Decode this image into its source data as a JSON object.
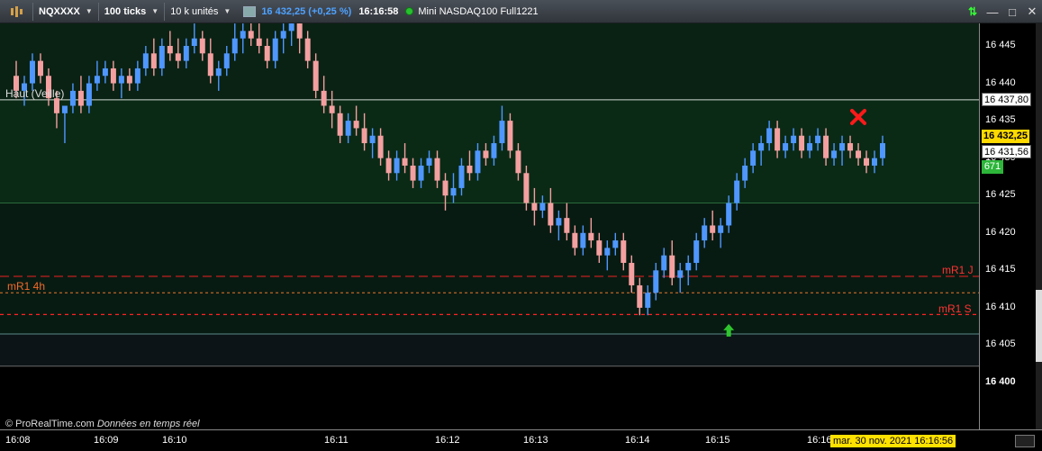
{
  "toolbar": {
    "symbol": "NQXXXX",
    "interval": "100 ticks",
    "units": "10 k unités",
    "last_price": "16 432,25 (+0,25 %)",
    "time": "16:16:58",
    "instrument": "Mini NASDAQ100 Full1221",
    "window_buttons": {
      "minimize": "—",
      "maximize": "□",
      "close": "✕"
    }
  },
  "chart": {
    "y_ticks": [
      {
        "label": "16 445",
        "value": 16445
      },
      {
        "label": "16 440",
        "value": 16440
      },
      {
        "label": "16 435",
        "value": 16435
      },
      {
        "label": "16 430",
        "value": 16430
      },
      {
        "label": "16 425",
        "value": 16425
      },
      {
        "label": "16 420",
        "value": 16420
      },
      {
        "label": "16 415",
        "value": 16415
      },
      {
        "label": "16 410",
        "value": 16410
      },
      {
        "label": "16 405",
        "value": 16405
      },
      {
        "label": "16 400",
        "value": 16400
      }
    ],
    "x_ticks": [
      "16:08",
      "16:09",
      "16:10",
      "16:11",
      "16:12",
      "16:13",
      "16:14",
      "16:15",
      "16:16"
    ],
    "price_boxes": {
      "high": "16 437,80",
      "last": "16 432,25",
      "avg": "16 431,56",
      "volume": "671"
    },
    "labels": {
      "haut": "Haut (Veille)",
      "mr1_4h": "mR1 4h",
      "mr1_j": "mR1 J",
      "mr1_s": "mR1 S"
    },
    "footer_brand": "ProRealTime.com",
    "footer_status": "Données en temps réel",
    "timestamp": "mar. 30 nov. 2021 16:16:56",
    "colors": {
      "up": "#4f97ff",
      "down": "#f4a0a0",
      "zone_top": "#0a2214",
      "zone_mid": "#081b12",
      "zone_low": "#0c1418"
    },
    "levels": {
      "haut_veille": 16437.8,
      "level_a": 16424,
      "mr1_j": 16414.2,
      "mr1_4h": 16412.0,
      "mr1_s": 16409.1,
      "level_b": 16406.5,
      "level_c": 16402.2
    },
    "markers": {
      "sell_x": {
        "bar": 104,
        "price": 16435.5
      },
      "buy_arrow": {
        "bar": 88,
        "price": 16407.0
      }
    }
  },
  "chart_data": {
    "type": "candlestick",
    "title": "",
    "ylim": [
      16397,
      16449
    ],
    "series": [
      {
        "values": [
          [
            16441,
            16443,
            16438,
            16439
          ],
          [
            16439,
            16441,
            16437,
            16440
          ],
          [
            16440,
            16444,
            16439,
            16443
          ],
          [
            16443,
            16444,
            16440,
            16441
          ],
          [
            16441,
            16442,
            16437,
            16438
          ],
          [
            16438,
            16439,
            16434,
            16436
          ],
          [
            16436,
            16437,
            16432,
            16437
          ],
          [
            16437,
            16440,
            16436,
            16439
          ],
          [
            16439,
            16441,
            16436,
            16437
          ],
          [
            16437,
            16441,
            16436,
            16440
          ],
          [
            16440,
            16443,
            16439,
            16441
          ],
          [
            16441,
            16443,
            16440,
            16442
          ],
          [
            16442,
            16443,
            16439,
            16440
          ],
          [
            16440,
            16442,
            16438,
            16441
          ],
          [
            16441,
            16442,
            16439,
            16440
          ],
          [
            16440,
            16443,
            16439,
            16442
          ],
          [
            16442,
            16445,
            16441,
            16444
          ],
          [
            16444,
            16446,
            16441,
            16442
          ],
          [
            16442,
            16446,
            16441,
            16445
          ],
          [
            16445,
            16447,
            16443,
            16444
          ],
          [
            16444,
            16446,
            16442,
            16443
          ],
          [
            16443,
            16446,
            16442,
            16445
          ],
          [
            16445,
            16448,
            16444,
            16446
          ],
          [
            16446,
            16447,
            16443,
            16444
          ],
          [
            16444,
            16446,
            16440,
            16441
          ],
          [
            16441,
            16443,
            16439,
            16442
          ],
          [
            16442,
            16445,
            16441,
            16444
          ],
          [
            16444,
            16448,
            16443,
            16446
          ],
          [
            16446,
            16448,
            16444,
            16447
          ],
          [
            16447,
            16449,
            16445,
            16446
          ],
          [
            16446,
            16448,
            16444,
            16445
          ],
          [
            16445,
            16446,
            16442,
            16443
          ],
          [
            16443,
            16447,
            16442,
            16446
          ],
          [
            16446,
            16448,
            16444,
            16447
          ],
          [
            16447,
            16449,
            16445,
            16448
          ],
          [
            16448,
            16449,
            16444,
            16446
          ],
          [
            16446,
            16447,
            16442,
            16443
          ],
          [
            16443,
            16444,
            16438,
            16439
          ],
          [
            16439,
            16441,
            16436,
            16437
          ],
          [
            16437,
            16439,
            16434,
            16436
          ],
          [
            16436,
            16437,
            16432,
            16433
          ],
          [
            16433,
            16436,
            16432,
            16435
          ],
          [
            16435,
            16437,
            16433,
            16434
          ],
          [
            16434,
            16436,
            16431,
            16432
          ],
          [
            16432,
            16434,
            16430,
            16433
          ],
          [
            16433,
            16434,
            16429,
            16430
          ],
          [
            16430,
            16431,
            16427,
            16428
          ],
          [
            16428,
            16431,
            16427,
            16430
          ],
          [
            16430,
            16432,
            16428,
            16429
          ],
          [
            16429,
            16430,
            16426,
            16427
          ],
          [
            16427,
            16430,
            16426,
            16429
          ],
          [
            16429,
            16431,
            16428,
            16430
          ],
          [
            16430,
            16431,
            16426,
            16427
          ],
          [
            16427,
            16428,
            16423,
            16425
          ],
          [
            16425,
            16428,
            16424,
            16426
          ],
          [
            16426,
            16430,
            16425,
            16429
          ],
          [
            16429,
            16431,
            16427,
            16428
          ],
          [
            16428,
            16432,
            16427,
            16431
          ],
          [
            16431,
            16432,
            16429,
            16430
          ],
          [
            16430,
            16433,
            16429,
            16432
          ],
          [
            16432,
            16437,
            16431,
            16435
          ],
          [
            16435,
            16436,
            16430,
            16431
          ],
          [
            16431,
            16432,
            16427,
            16428
          ],
          [
            16428,
            16429,
            16423,
            16424
          ],
          [
            16424,
            16426,
            16421,
            16423
          ],
          [
            16423,
            16425,
            16422,
            16424
          ],
          [
            16424,
            16426,
            16420,
            16421
          ],
          [
            16421,
            16423,
            16419,
            16422
          ],
          [
            16422,
            16424,
            16419,
            16420
          ],
          [
            16420,
            16421,
            16417,
            16418
          ],
          [
            16418,
            16421,
            16417,
            16420
          ],
          [
            16420,
            16422,
            16418,
            16419
          ],
          [
            16419,
            16420,
            16416,
            16417
          ],
          [
            16417,
            16419,
            16415,
            16418
          ],
          [
            16418,
            16420,
            16417,
            16419
          ],
          [
            16419,
            16420,
            16415,
            16416
          ],
          [
            16416,
            16417,
            16412,
            16413
          ],
          [
            16413,
            16414,
            16409,
            16410
          ],
          [
            16410,
            16413,
            16409,
            16412
          ],
          [
            16412,
            16416,
            16411,
            16415
          ],
          [
            16415,
            16418,
            16414,
            16417
          ],
          [
            16417,
            16419,
            16413,
            16414
          ],
          [
            16414,
            16416,
            16412,
            16415
          ],
          [
            16415,
            16417,
            16413,
            16416
          ],
          [
            16416,
            16420,
            16415,
            16419
          ],
          [
            16419,
            16422,
            16418,
            16421
          ],
          [
            16421,
            16423,
            16419,
            16420
          ],
          [
            16420,
            16422,
            16418,
            16421
          ],
          [
            16421,
            16425,
            16420,
            16424
          ],
          [
            16424,
            16428,
            16423,
            16427
          ],
          [
            16427,
            16430,
            16426,
            16429
          ],
          [
            16429,
            16432,
            16428,
            16431
          ],
          [
            16431,
            16433,
            16429,
            16432
          ],
          [
            16432,
            16435,
            16431,
            16434
          ],
          [
            16434,
            16435,
            16430,
            16431
          ],
          [
            16431,
            16433,
            16430,
            16432
          ],
          [
            16432,
            16434,
            16431,
            16433
          ],
          [
            16433,
            16434,
            16430,
            16431
          ],
          [
            16431,
            16433,
            16430,
            16432
          ],
          [
            16432,
            16434,
            16431,
            16433
          ],
          [
            16433,
            16434,
            16429,
            16430
          ],
          [
            16430,
            16432,
            16429,
            16431
          ],
          [
            16431,
            16433,
            16429,
            16432
          ],
          [
            16432,
            16433,
            16430,
            16431
          ],
          [
            16431,
            16432,
            16429,
            16430
          ],
          [
            16430,
            16431,
            16428,
            16429
          ],
          [
            16429,
            16431,
            16428,
            16430
          ],
          [
            16430,
            16433,
            16429,
            16432
          ]
        ]
      }
    ]
  }
}
